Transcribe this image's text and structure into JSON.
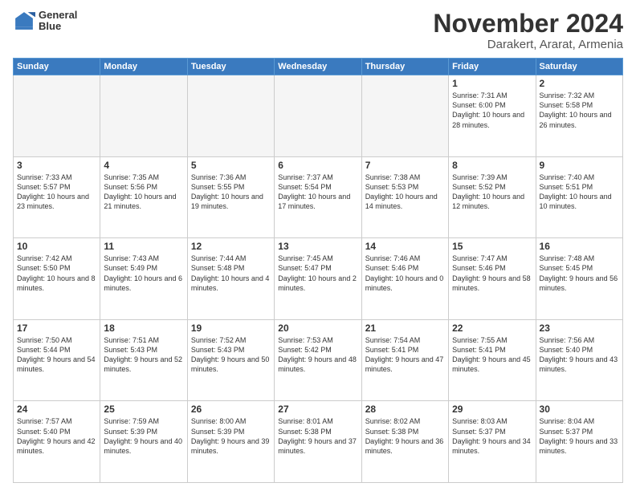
{
  "header": {
    "logo_line1": "General",
    "logo_line2": "Blue",
    "month": "November 2024",
    "location": "Darakert, Ararat, Armenia"
  },
  "days_of_week": [
    "Sunday",
    "Monday",
    "Tuesday",
    "Wednesday",
    "Thursday",
    "Friday",
    "Saturday"
  ],
  "weeks": [
    [
      {
        "day": "",
        "info": ""
      },
      {
        "day": "",
        "info": ""
      },
      {
        "day": "",
        "info": ""
      },
      {
        "day": "",
        "info": ""
      },
      {
        "day": "",
        "info": ""
      },
      {
        "day": "1",
        "info": "Sunrise: 7:31 AM\nSunset: 6:00 PM\nDaylight: 10 hours and 28 minutes."
      },
      {
        "day": "2",
        "info": "Sunrise: 7:32 AM\nSunset: 5:58 PM\nDaylight: 10 hours and 26 minutes."
      }
    ],
    [
      {
        "day": "3",
        "info": "Sunrise: 7:33 AM\nSunset: 5:57 PM\nDaylight: 10 hours and 23 minutes."
      },
      {
        "day": "4",
        "info": "Sunrise: 7:35 AM\nSunset: 5:56 PM\nDaylight: 10 hours and 21 minutes."
      },
      {
        "day": "5",
        "info": "Sunrise: 7:36 AM\nSunset: 5:55 PM\nDaylight: 10 hours and 19 minutes."
      },
      {
        "day": "6",
        "info": "Sunrise: 7:37 AM\nSunset: 5:54 PM\nDaylight: 10 hours and 17 minutes."
      },
      {
        "day": "7",
        "info": "Sunrise: 7:38 AM\nSunset: 5:53 PM\nDaylight: 10 hours and 14 minutes."
      },
      {
        "day": "8",
        "info": "Sunrise: 7:39 AM\nSunset: 5:52 PM\nDaylight: 10 hours and 12 minutes."
      },
      {
        "day": "9",
        "info": "Sunrise: 7:40 AM\nSunset: 5:51 PM\nDaylight: 10 hours and 10 minutes."
      }
    ],
    [
      {
        "day": "10",
        "info": "Sunrise: 7:42 AM\nSunset: 5:50 PM\nDaylight: 10 hours and 8 minutes."
      },
      {
        "day": "11",
        "info": "Sunrise: 7:43 AM\nSunset: 5:49 PM\nDaylight: 10 hours and 6 minutes."
      },
      {
        "day": "12",
        "info": "Sunrise: 7:44 AM\nSunset: 5:48 PM\nDaylight: 10 hours and 4 minutes."
      },
      {
        "day": "13",
        "info": "Sunrise: 7:45 AM\nSunset: 5:47 PM\nDaylight: 10 hours and 2 minutes."
      },
      {
        "day": "14",
        "info": "Sunrise: 7:46 AM\nSunset: 5:46 PM\nDaylight: 10 hours and 0 minutes."
      },
      {
        "day": "15",
        "info": "Sunrise: 7:47 AM\nSunset: 5:46 PM\nDaylight: 9 hours and 58 minutes."
      },
      {
        "day": "16",
        "info": "Sunrise: 7:48 AM\nSunset: 5:45 PM\nDaylight: 9 hours and 56 minutes."
      }
    ],
    [
      {
        "day": "17",
        "info": "Sunrise: 7:50 AM\nSunset: 5:44 PM\nDaylight: 9 hours and 54 minutes."
      },
      {
        "day": "18",
        "info": "Sunrise: 7:51 AM\nSunset: 5:43 PM\nDaylight: 9 hours and 52 minutes."
      },
      {
        "day": "19",
        "info": "Sunrise: 7:52 AM\nSunset: 5:43 PM\nDaylight: 9 hours and 50 minutes."
      },
      {
        "day": "20",
        "info": "Sunrise: 7:53 AM\nSunset: 5:42 PM\nDaylight: 9 hours and 48 minutes."
      },
      {
        "day": "21",
        "info": "Sunrise: 7:54 AM\nSunset: 5:41 PM\nDaylight: 9 hours and 47 minutes."
      },
      {
        "day": "22",
        "info": "Sunrise: 7:55 AM\nSunset: 5:41 PM\nDaylight: 9 hours and 45 minutes."
      },
      {
        "day": "23",
        "info": "Sunrise: 7:56 AM\nSunset: 5:40 PM\nDaylight: 9 hours and 43 minutes."
      }
    ],
    [
      {
        "day": "24",
        "info": "Sunrise: 7:57 AM\nSunset: 5:40 PM\nDaylight: 9 hours and 42 minutes."
      },
      {
        "day": "25",
        "info": "Sunrise: 7:59 AM\nSunset: 5:39 PM\nDaylight: 9 hours and 40 minutes."
      },
      {
        "day": "26",
        "info": "Sunrise: 8:00 AM\nSunset: 5:39 PM\nDaylight: 9 hours and 39 minutes."
      },
      {
        "day": "27",
        "info": "Sunrise: 8:01 AM\nSunset: 5:38 PM\nDaylight: 9 hours and 37 minutes."
      },
      {
        "day": "28",
        "info": "Sunrise: 8:02 AM\nSunset: 5:38 PM\nDaylight: 9 hours and 36 minutes."
      },
      {
        "day": "29",
        "info": "Sunrise: 8:03 AM\nSunset: 5:37 PM\nDaylight: 9 hours and 34 minutes."
      },
      {
        "day": "30",
        "info": "Sunrise: 8:04 AM\nSunset: 5:37 PM\nDaylight: 9 hours and 33 minutes."
      }
    ]
  ]
}
